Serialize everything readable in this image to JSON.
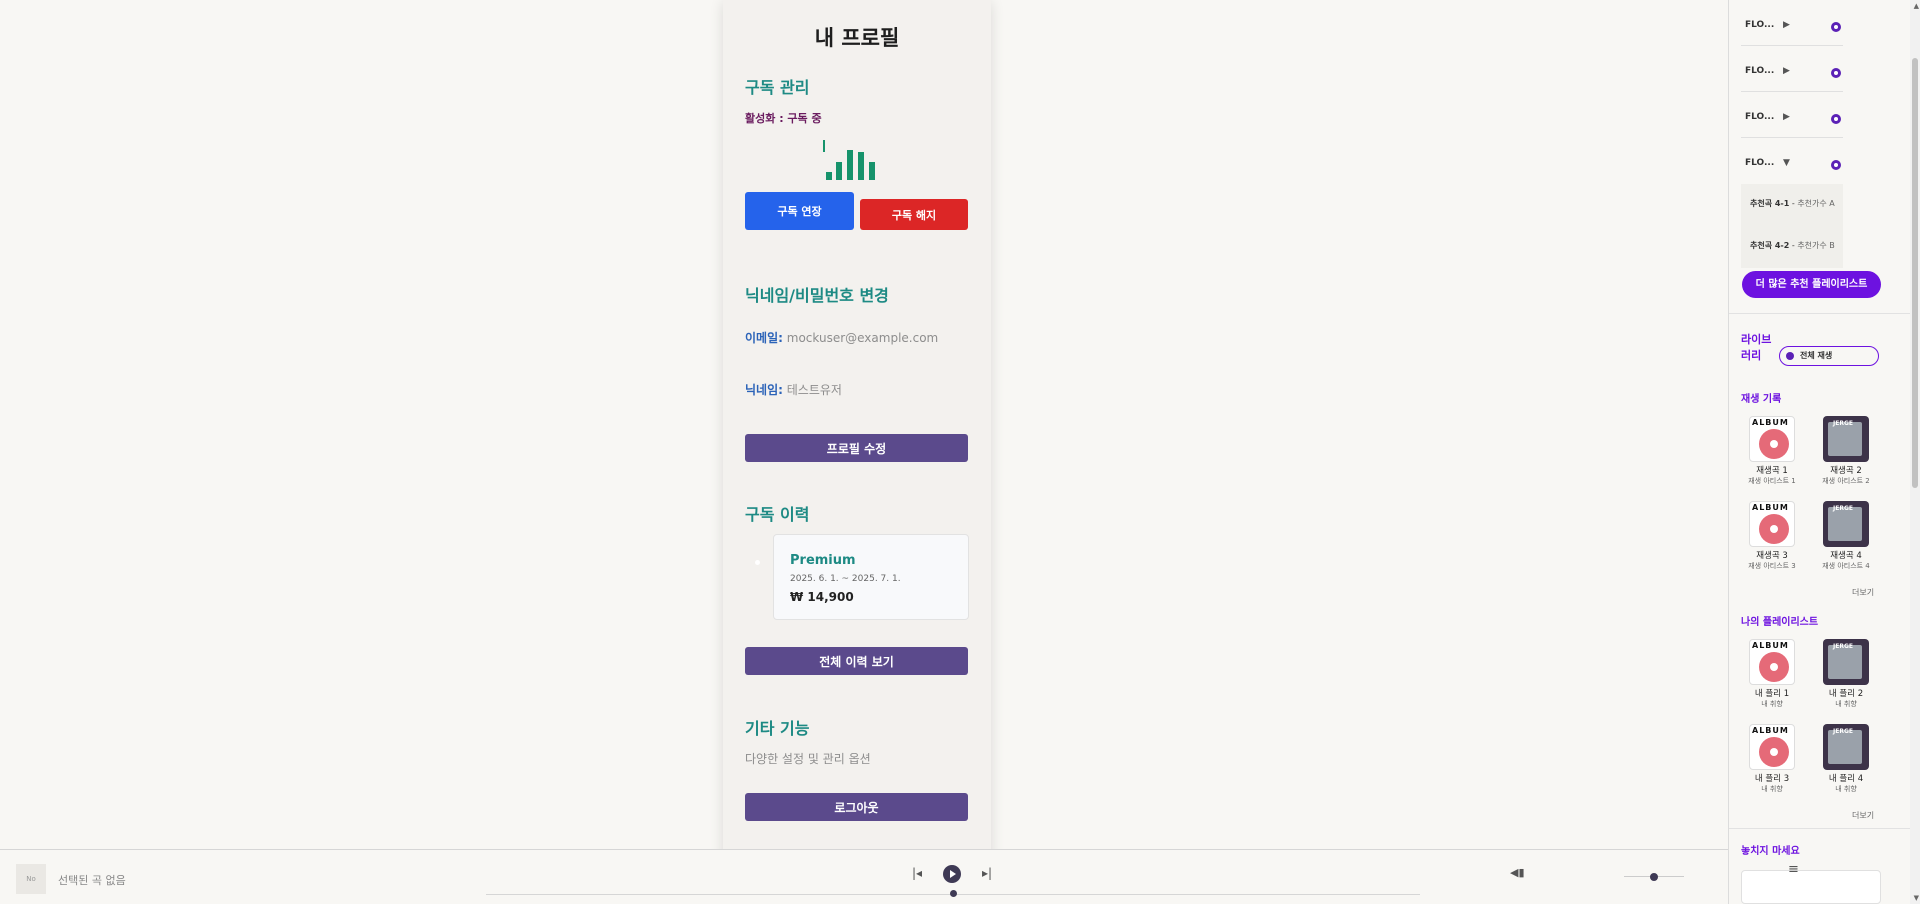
{
  "profile": {
    "title": "내 프로필",
    "subscription": {
      "heading": "구독 관리",
      "status": "활성화 : 구독 중",
      "extend_label": "구독 연장",
      "cancel_label": "구독 해지"
    },
    "account": {
      "heading": "닉네임/비밀번호 변경",
      "email_label": "이메일:",
      "email_value": "mockuser@example.com",
      "nickname_label": "닉네임:",
      "nickname_value": "테스트유저",
      "edit_label": "프로필 수정"
    },
    "history": {
      "heading": "구독 이력",
      "plan": "Premium",
      "period": "2025. 6. 1. ~ 2025. 7. 1.",
      "price": "₩ 14,900",
      "view_all_label": "전체 이력 보기"
    },
    "other": {
      "heading": "기타 기능",
      "description": "다양한 설정 및 관리 옵션",
      "logout_label": "로그아웃"
    }
  },
  "sidebar": {
    "recommended": [
      {
        "name": "FLO...",
        "expanded": false
      },
      {
        "name": "FLO...",
        "expanded": false
      },
      {
        "name": "FLO...",
        "expanded": false
      },
      {
        "name": "FLO...",
        "expanded": true
      }
    ],
    "sub_tracks": [
      {
        "title": "추천곡 4-1",
        "artist": "추천가수 A"
      },
      {
        "title": "추천곡 4-2",
        "artist": "추천가수 B"
      }
    ],
    "more_playlists_label": "더 많은 추천 플레이리스트",
    "library_title": "라이브러리",
    "play_all_label": "전체 재생",
    "history_heading": "재생 기록",
    "history": [
      {
        "title": "재생곡 1",
        "artist": "재생 아티스트 1",
        "art": "album"
      },
      {
        "title": "재생곡 2",
        "artist": "재생 아티스트 2",
        "art": "jerge"
      },
      {
        "title": "재생곡 3",
        "artist": "재생 아티스트 3",
        "art": "album"
      },
      {
        "title": "재생곡 4",
        "artist": "재생 아티스트 4",
        "art": "jerge"
      }
    ],
    "more_label": "더보기",
    "my_playlists_heading": "나의 플레이리스트",
    "my_playlists": [
      {
        "title": "내 플리 1",
        "sub": "내 취향",
        "art": "album"
      },
      {
        "title": "내 플리 2",
        "sub": "내 취향",
        "art": "jerge"
      },
      {
        "title": "내 플리 3",
        "sub": "내 취향",
        "art": "album"
      },
      {
        "title": "내 플리 4",
        "sub": "내 취향",
        "art": "jerge"
      }
    ],
    "featured_heading": "놓치지 마세요"
  },
  "player": {
    "thumb_placeholder": "No",
    "track_label": "선택된 곡 없음"
  },
  "colors": {
    "accent_purple": "#6d12e0",
    "teal_heading": "#1d8a84",
    "primary_blue": "#2563eb",
    "danger_red": "#dc2626",
    "muted_purple": "#5b4a8c"
  }
}
